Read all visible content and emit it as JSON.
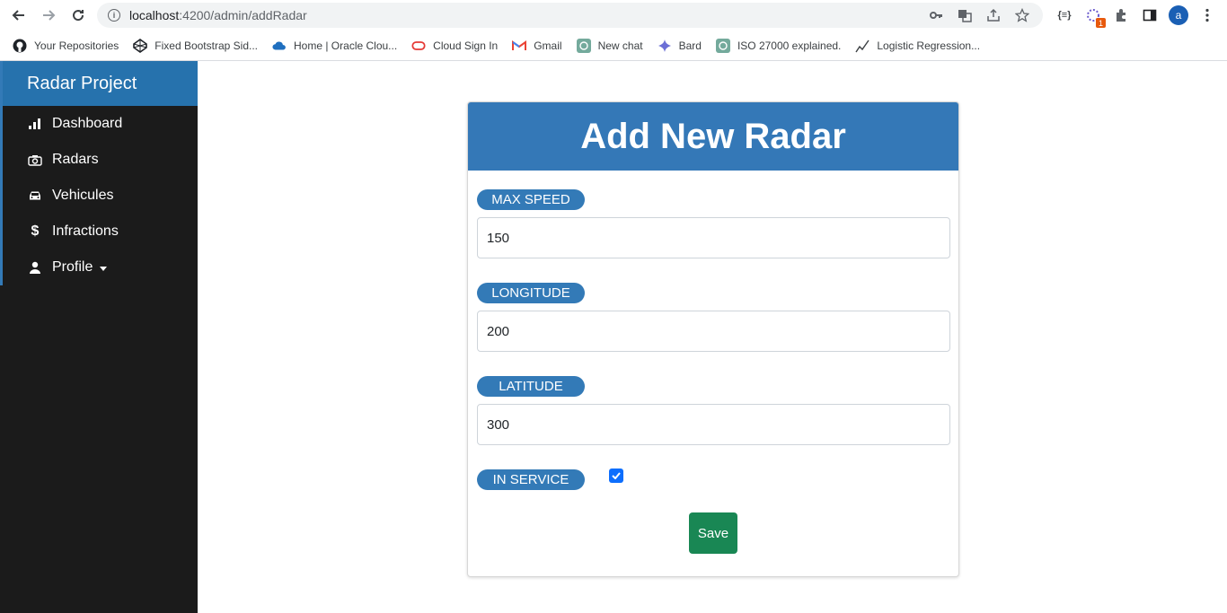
{
  "browser": {
    "url_host": "localhost",
    "url_path": ":4200/admin/addRadar",
    "bookmarks": [
      {
        "label": "Your Repositories",
        "icon": "github-icon"
      },
      {
        "label": "Fixed Bootstrap Sid...",
        "icon": "codepen-icon"
      },
      {
        "label": "Home | Oracle Clou...",
        "icon": "cloud-icon"
      },
      {
        "label": "Cloud Sign In",
        "icon": "oracle-icon"
      },
      {
        "label": "Gmail",
        "icon": "gmail-icon"
      },
      {
        "label": "New chat",
        "icon": "chatgpt-icon"
      },
      {
        "label": "Bard",
        "icon": "bard-icon"
      },
      {
        "label": "ISO 27000 explained.",
        "icon": "chatgpt-icon"
      },
      {
        "label": "Logistic Regression...",
        "icon": "chart-icon"
      }
    ],
    "avatar_letter": "a",
    "extension_badge": "1"
  },
  "sidebar": {
    "brand": "Radar Project",
    "items": [
      {
        "label": "Dashboard",
        "icon": "bar-chart-icon"
      },
      {
        "label": "Radars",
        "icon": "camera-icon"
      },
      {
        "label": "Vehicules",
        "icon": "car-icon"
      },
      {
        "label": "Infractions",
        "icon": "dollar-icon"
      },
      {
        "label": "Profile",
        "icon": "user-icon"
      }
    ]
  },
  "form": {
    "title": "Add New Radar",
    "max_speed_label": "MAX SPEED",
    "max_speed_value": "150",
    "longitude_label": "LONGITUDE",
    "longitude_value": "200",
    "latitude_label": "LATITUDE",
    "latitude_value": "300",
    "in_service_label": "IN SERVICE",
    "in_service_checked": true,
    "save_label": "Save"
  },
  "colors": {
    "primary": "#337ab7",
    "sidebar_bg": "#1b1b1b",
    "save": "#198754",
    "checkbox": "#0d6efd"
  }
}
